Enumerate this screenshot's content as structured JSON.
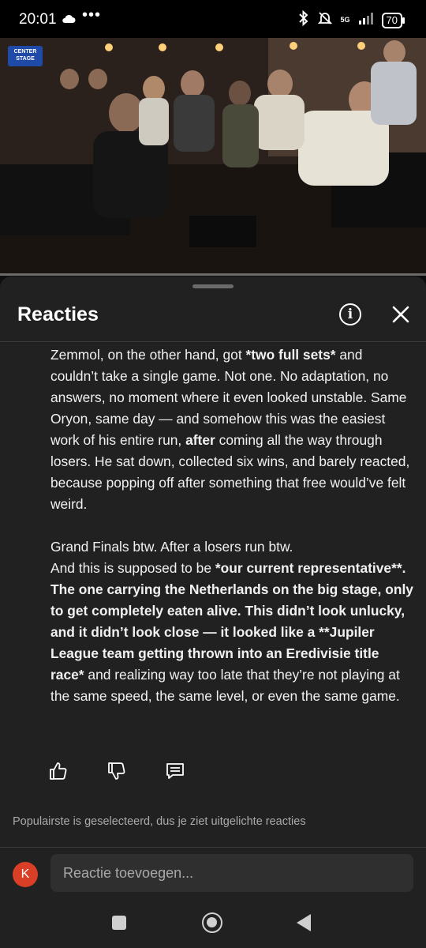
{
  "status_bar": {
    "time": "20:01",
    "dots": "•••",
    "network": "5G",
    "battery": "70"
  },
  "video": {
    "channel_badge": "CENTER STAGE"
  },
  "comments_panel": {
    "title": "Reacties",
    "info_icon": "info-icon",
    "close_icon": "close-icon",
    "comment": {
      "p1_a": "Zemmol, on the other hand, got ",
      "p1_b": "*two full sets*",
      "p1_c": " and couldn’t take a single game. Not one. No adaptation, no answers, no moment where it even looked unstable. Same Oryon, same day — and somehow this was the easiest work of his entire run, ",
      "p1_d": "after",
      "p1_e": " coming all the way through losers. He sat down, collected six wins, and barely reacted, because popping off after something that free would’ve felt weird.",
      "p2_a": "Grand Finals btw. After a losers run btw.",
      "p2_b": "And this is supposed to be ",
      "p2_c": "*our current representative**. The one carrying the Netherlands on the big stage, only to get completely eaten alive. This didn’t look unlucky, and it didn’t look close — it looked like a **Jupiler League team getting thrown into an Eredivisie title race*",
      "p2_d": " and realizing way too late that they’re not playing at the same speed, the same level, or even the same game."
    },
    "actions": [
      "like-icon",
      "dislike-icon",
      "reply-icon"
    ],
    "sort_notice": "Populairste is geselecteerd, dus je ziet uitgelichte reacties",
    "avatar_letter": "K",
    "reply_placeholder": "Reactie toevoegen..."
  },
  "colors": {
    "sheet_bg": "#212121",
    "avatar_bg": "#d93f27",
    "input_bg": "#2f2f2f"
  }
}
